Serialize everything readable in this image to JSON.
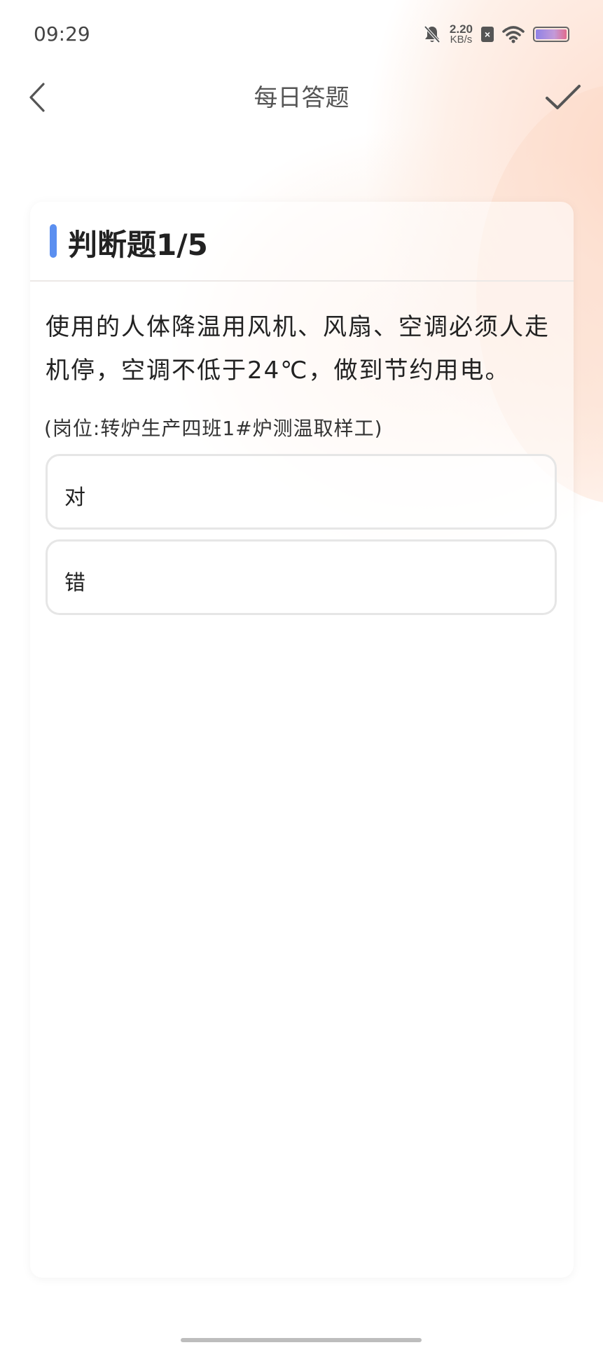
{
  "status_bar": {
    "time": "09:29",
    "net_speed_value": "2.20",
    "net_speed_unit": "KB/s",
    "sim_label": "×"
  },
  "nav": {
    "title": "每日答题"
  },
  "card": {
    "question_type": "判断题1/5",
    "question_text": "使用的人体降温用风机、风扇、空调必须人走机停，空调不低于24℃，做到节约用电。",
    "post_label": "(岗位:转炉生产四班1#炉测温取样工)",
    "options": [
      {
        "label": "对"
      },
      {
        "label": "错"
      }
    ]
  },
  "colors": {
    "accent": "#5b8ff0",
    "background_tint": "#fdd6c4"
  }
}
